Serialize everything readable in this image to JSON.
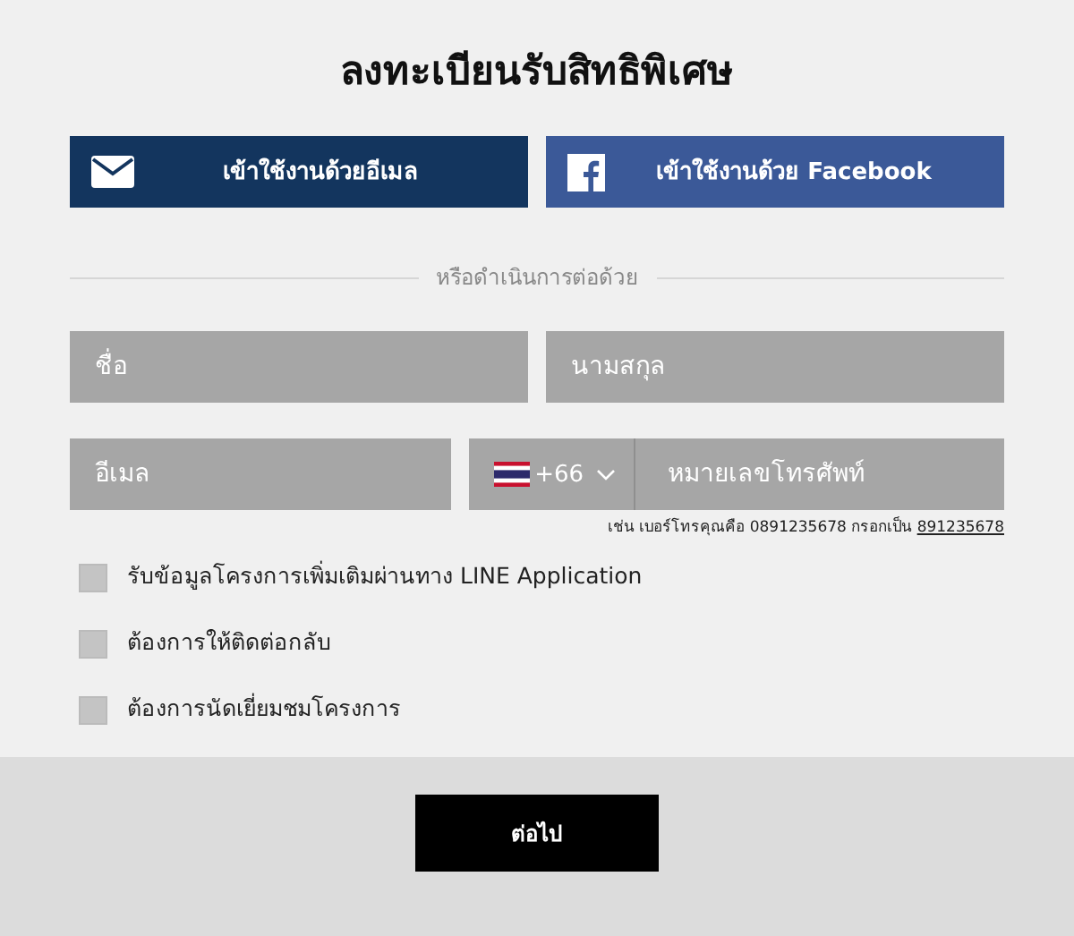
{
  "title": "ลงทะเบียนรับสิทธิพิเศษ",
  "login_buttons": [
    {
      "kind": "email",
      "label": "เข้าใช้งานด้วยอีเมล"
    },
    {
      "kind": "facebook",
      "label": "เข้าใช้งานด้วย Facebook"
    }
  ],
  "divider_text": "หรือดำเนินการต่อด้วย",
  "fields": [
    {
      "placeholder": "ชื่อ"
    },
    {
      "placeholder": "นามสกุล"
    },
    {
      "placeholder": "อีเมล"
    }
  ],
  "phone": {
    "country_code": "+66",
    "placeholder": "หมายเลขโทรศัพท์",
    "hint": "เช่น เบอร์โทรคุณคือ 0891235678 กรอกเป็น",
    "hint_example": "891235678"
  },
  "checkboxes": [
    {
      "label": "รับข้อมูลโครงการเพิ่มเติมผ่านทาง LINE Application",
      "checked": false
    },
    {
      "label": "ต้องการให้ติดต่อกลับ",
      "checked": false
    },
    {
      "label": "ต้องการนัดเยี่ยมชมโครงการ",
      "checked": false
    }
  ],
  "submit": "ต่อไป"
}
